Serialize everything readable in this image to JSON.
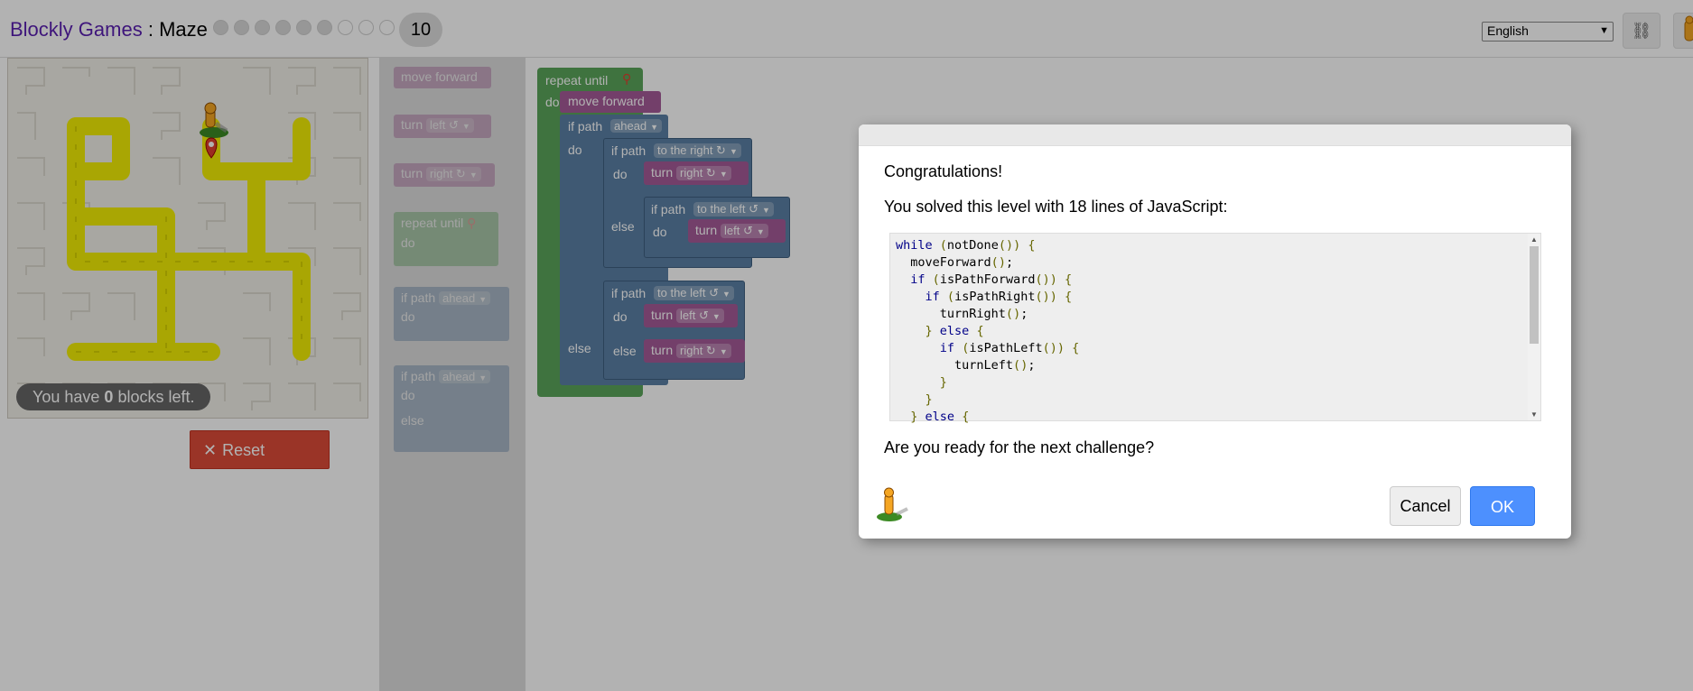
{
  "header": {
    "brand": "Blockly Games",
    "separator": " : ",
    "game": "Maze",
    "current_level": "10",
    "completed_levels": 6,
    "total_level_dots": 9,
    "language": "English"
  },
  "maze": {
    "blocks_left_prefix": "You have ",
    "blocks_left_count": "0",
    "blocks_left_suffix": " blocks left.",
    "reset_label": "Reset"
  },
  "toolbox": {
    "move_forward": "move forward",
    "turn": "turn",
    "left": "left ↺",
    "right": "right ↻",
    "repeat_until": "repeat until",
    "do": "do",
    "else": "else",
    "if_path": "if path",
    "ahead": "ahead"
  },
  "workspace": {
    "repeat_until": "repeat until",
    "do": "do",
    "else": "else",
    "move_forward": "move forward",
    "if_path": "if path",
    "ahead": "ahead",
    "to_the_right": "to the right ↻",
    "to_the_left": "to the left ↺",
    "turn": "turn",
    "right": "right ↻",
    "left": "left ↺"
  },
  "dialog": {
    "congrats": "Congratulations!",
    "solved": "You solved this level with 18 lines of JavaScript:",
    "code_lines": [
      "while (notDone()) {",
      "  moveForward();",
      "  if (isPathForward()) {",
      "    if (isPathRight()) {",
      "      turnRight();",
      "    } else {",
      "      if (isPathLeft()) {",
      "        turnLeft();",
      "      }",
      "    }",
      "  } else {"
    ],
    "next_challenge": "Are you ready for the next challenge?",
    "cancel_label": "Cancel",
    "ok_label": "OK"
  },
  "colors": {
    "brand": "#5a1fb0",
    "loop_block": "#5ba55b",
    "logic_block": "#5b80a5",
    "action_block": "#a55b99",
    "maze_path": "#f2ee05",
    "reset": "#dd4b39",
    "ok": "#4d90fe"
  }
}
